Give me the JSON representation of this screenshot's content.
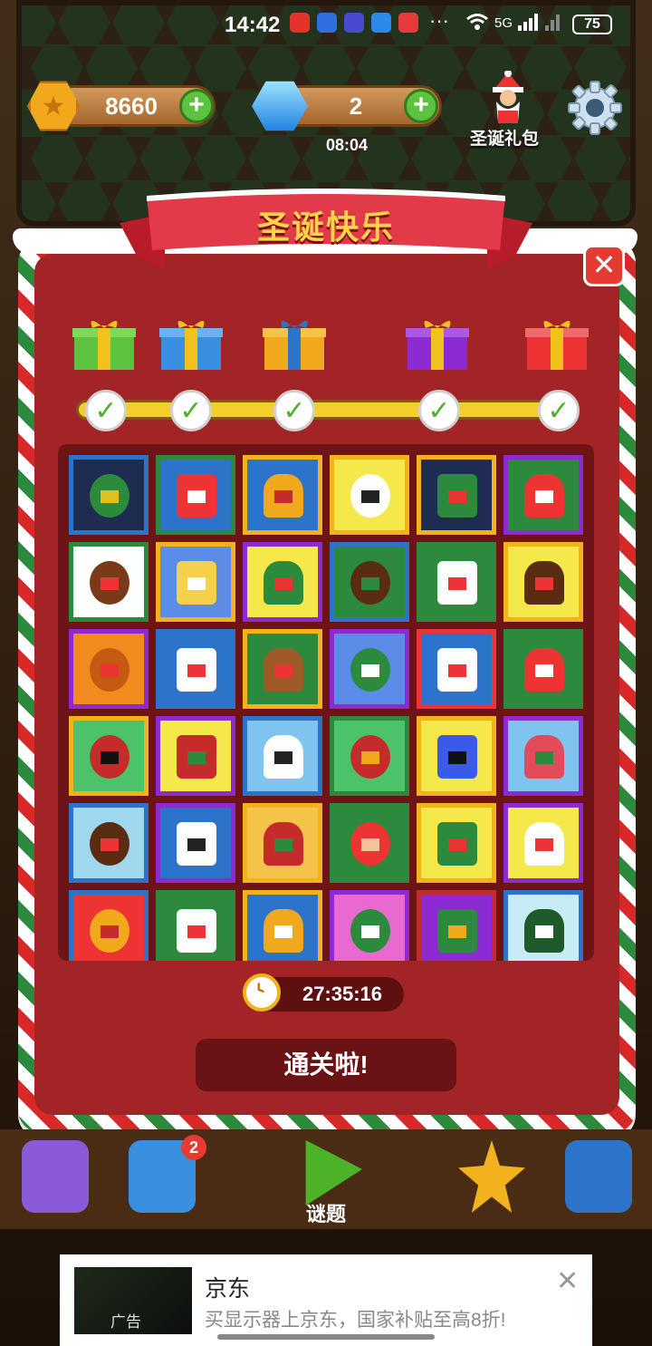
{
  "status_bar": {
    "time": "14:42",
    "dots": "···",
    "net": "5G",
    "battery": "75"
  },
  "hud": {
    "coins": "8660",
    "gems": "2",
    "gem_timer": "08:04",
    "santa_gift_label": "圣诞礼包"
  },
  "dialog": {
    "title": "圣诞快乐",
    "timer": "27:35:16",
    "clear_label": "通关啦!",
    "progress": {
      "milestones": 5,
      "completed": 5
    }
  },
  "colors": {
    "dialog_red": "#a32426",
    "panel_red": "#6e1416",
    "title_gold": "#ffd34a",
    "check_green": "#4cb329"
  },
  "puzzles": [
    {
      "name": "green-tree-blocks",
      "border": "#2b74c9",
      "bg": "#1e2c52",
      "fg": "#2c8a3c",
      "accent": "#e0c020"
    },
    {
      "name": "santa-face",
      "border": "#2c8a3c",
      "bg": "#2b74c9",
      "fg": "#e33",
      "accent": "#fff"
    },
    {
      "name": "golden-bell",
      "border": "#f2b21c",
      "bg": "#2b74c9",
      "fg": "#f2a81d",
      "accent": "#c52b2b"
    },
    {
      "name": "snowman-top-hat",
      "border": "#f2b21c",
      "bg": "#f5e84a",
      "fg": "#fff",
      "accent": "#222"
    },
    {
      "name": "christmas-tree",
      "border": "#f2b21c",
      "bg": "#1e2c52",
      "fg": "#2c8a3c",
      "accent": "#e33"
    },
    {
      "name": "santa-hat",
      "border": "#8b2bd1",
      "bg": "#2c8a3c",
      "fg": "#e33",
      "accent": "#fff"
    },
    {
      "name": "wreath-bear",
      "border": "#2c8a3c",
      "bg": "#fff",
      "fg": "#7a3a18",
      "accent": "#e33"
    },
    {
      "name": "yellow-ornament",
      "border": "#f2b21c",
      "bg": "#5b8de8",
      "fg": "#f5d04a",
      "accent": "#fff"
    },
    {
      "name": "yellow-wreath",
      "border": "#8b2bd1",
      "bg": "#f5e84a",
      "fg": "#2c8a3c",
      "accent": "#e33"
    },
    {
      "name": "reindeer-silhouette",
      "border": "#2b74c9",
      "bg": "#2c8a3c",
      "fg": "#5a2d12",
      "accent": "#2c8a3c"
    },
    {
      "name": "candy-cane",
      "border": "#2c8a3c",
      "bg": "#2c8a3c",
      "fg": "#fff",
      "accent": "#e33"
    },
    {
      "name": "reindeer-head",
      "border": "#f2b21c",
      "bg": "#f5e84a",
      "fg": "#5a2d12",
      "accent": "#e33"
    },
    {
      "name": "rudolph-face",
      "border": "#8b2bd1",
      "bg": "#f28b1d",
      "fg": "#c55a12",
      "accent": "#e33"
    },
    {
      "name": "snowman-scarf",
      "border": "#2b74c9",
      "bg": "#2b74c9",
      "fg": "#fff",
      "accent": "#e33"
    },
    {
      "name": "reindeer-sitting",
      "border": "#f2b21c",
      "bg": "#2c8a3c",
      "fg": "#a05a28",
      "accent": "#e33"
    },
    {
      "name": "snowy-trees",
      "border": "#8b2bd1",
      "bg": "#5b8de8",
      "fg": "#2c8a3c",
      "accent": "#fff"
    },
    {
      "name": "snowman-santa-hat",
      "border": "#e33",
      "bg": "#2b74c9",
      "fg": "#fff",
      "accent": "#e33"
    },
    {
      "name": "red-hat",
      "border": "#2c8a3c",
      "bg": "#2c8a3c",
      "fg": "#e33",
      "accent": "#fff"
    },
    {
      "name": "red-bow",
      "border": "#f2b21c",
      "bg": "#4cc26a",
      "fg": "#c52b2b",
      "accent": "#111"
    },
    {
      "name": "stocking",
      "border": "#8b2bd1",
      "bg": "#f5e84a",
      "fg": "#c52b2b",
      "accent": "#2c8a3c"
    },
    {
      "name": "cat-face",
      "border": "#2b74c9",
      "bg": "#7ec4ef",
      "fg": "#fff",
      "accent": "#222"
    },
    {
      "name": "gift-box-ribbon",
      "border": "#2c8a3c",
      "bg": "#4cc26a",
      "fg": "#c52b2b",
      "accent": "#f2a81d"
    },
    {
      "name": "butterfly",
      "border": "#f2b21c",
      "bg": "#f5e84a",
      "fg": "#3a5ae8",
      "accent": "#111"
    },
    {
      "name": "strawberry",
      "border": "#8b2bd1",
      "bg": "#7ec4ef",
      "fg": "#e34a5a",
      "accent": "#2c8a3c"
    },
    {
      "name": "winter-branch",
      "border": "#2b74c9",
      "bg": "#9fd8ef",
      "fg": "#5a2d12",
      "accent": "#e33"
    },
    {
      "name": "snowman-blue",
      "border": "#8b2bd1",
      "bg": "#2b74c9",
      "fg": "#fff",
      "accent": "#222"
    },
    {
      "name": "tomato",
      "border": "#f2b21c",
      "bg": "#f5c34a",
      "fg": "#c52b2b",
      "accent": "#2c8a3c"
    },
    {
      "name": "elf-boy",
      "border": "#2c8a3c",
      "bg": "#2c8a3c",
      "fg": "#e33",
      "accent": "#f5c39a"
    },
    {
      "name": "holly-leaves",
      "border": "#f2b21c",
      "bg": "#f5e84a",
      "fg": "#2c8a3c",
      "accent": "#e33"
    },
    {
      "name": "candy-cane-yellow",
      "border": "#8b2bd1",
      "bg": "#f5e84a",
      "fg": "#fff",
      "accent": "#e33"
    },
    {
      "name": "gift-box-gold",
      "border": "#2b74c9",
      "bg": "#e33",
      "fg": "#f2a81d",
      "accent": "#c52b2b"
    },
    {
      "name": "snowman-red-hat",
      "border": "#2c8a3c",
      "bg": "#2c8a3c",
      "fg": "#fff",
      "accent": "#e33"
    },
    {
      "name": "bird-branch",
      "border": "#f2b21c",
      "bg": "#2b74c9",
      "fg": "#f2a81d",
      "accent": "#fff"
    },
    {
      "name": "pink-tree",
      "border": "#8b2bd1",
      "bg": "#e86ad0",
      "fg": "#2c8a3c",
      "accent": "#fff"
    },
    {
      "name": "tree-star",
      "border": "#c52b2b",
      "bg": "#8b2bd1",
      "fg": "#2c8a3c",
      "accent": "#f2a81d"
    },
    {
      "name": "pine-corner",
      "border": "#2b74c9",
      "bg": "#c8ecf5",
      "fg": "#1e5a2a",
      "accent": "#fff"
    }
  ],
  "bottom_nav": {
    "puzzle_label": "谜题",
    "badge": "2"
  },
  "ad": {
    "title": "京东",
    "desc": "买显示器上京东，国家补贴至高8折!",
    "img_label": "广告",
    "close": "✕"
  }
}
